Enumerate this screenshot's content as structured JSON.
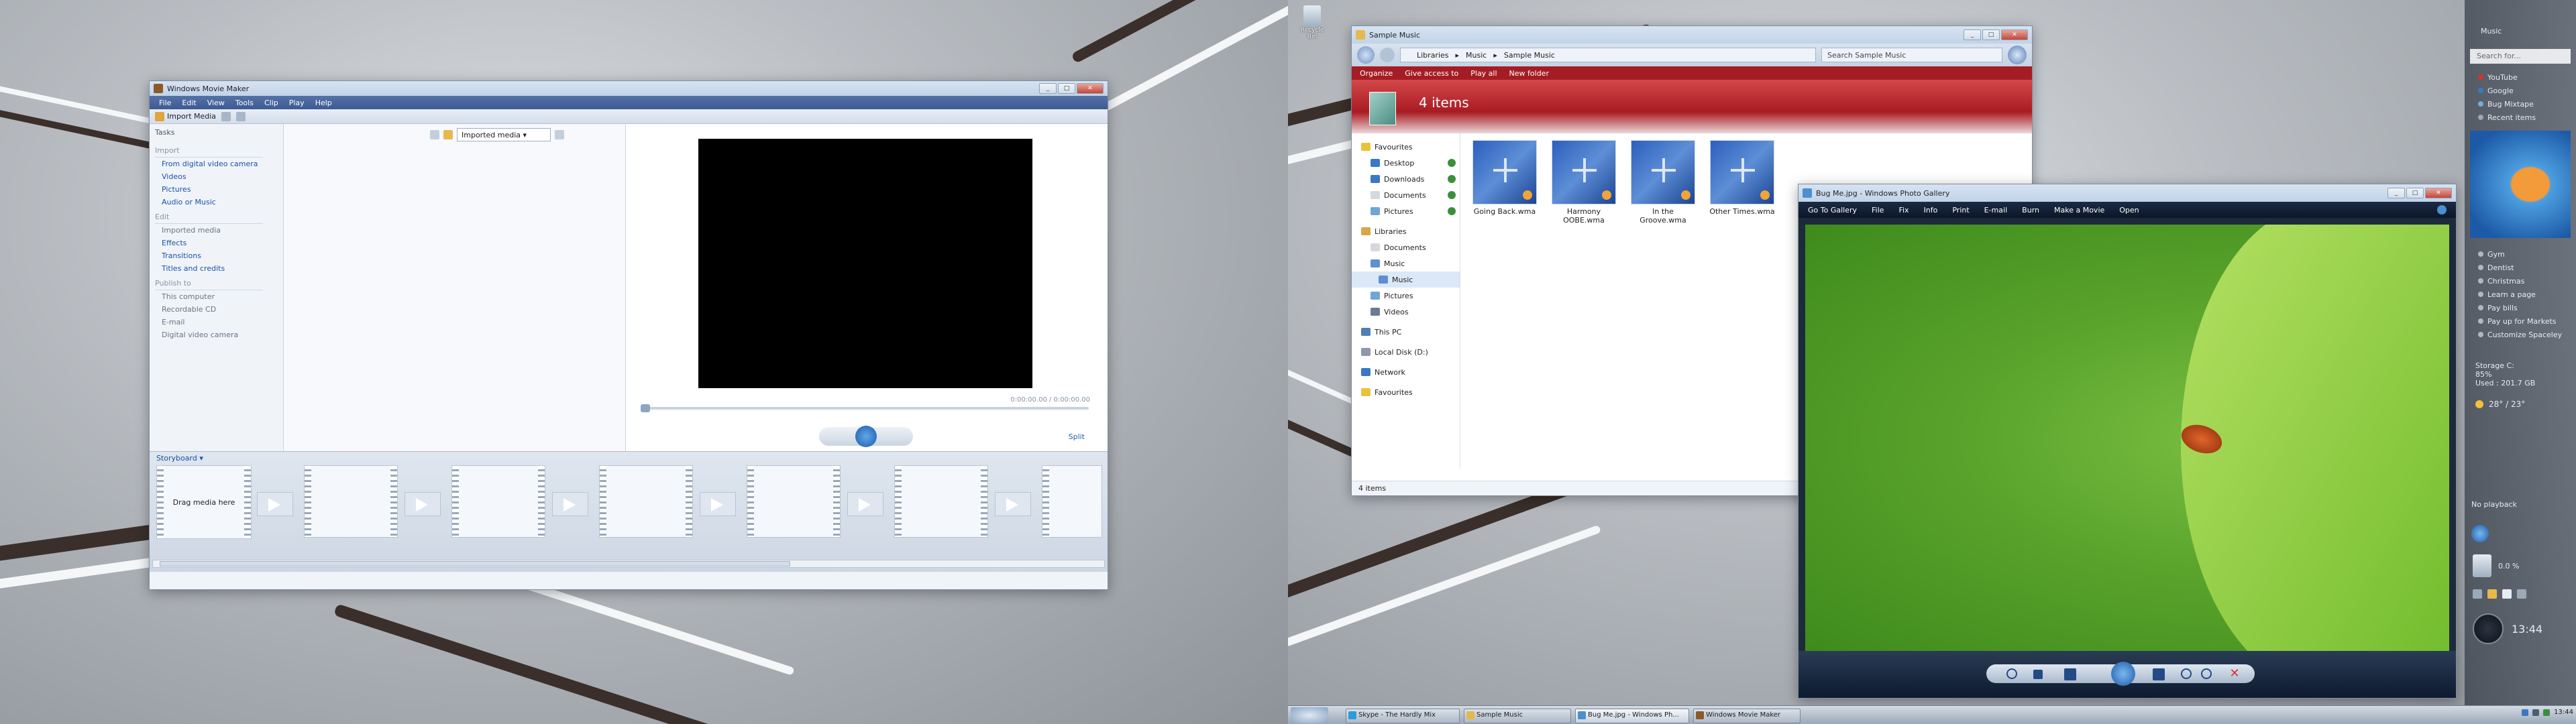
{
  "desktop": {
    "recycle_bin_label": "Recycle Bin"
  },
  "movie_maker": {
    "title": "Windows Movie Maker",
    "menu": [
      "File",
      "Edit",
      "View",
      "Tools",
      "Clip",
      "Play",
      "Help"
    ],
    "toolbar": {
      "import_media": "Import Media",
      "collection_select": "Imported media"
    },
    "tasks": {
      "heading": "Tasks",
      "import_heading": "Import",
      "import_links": [
        "From digital video camera",
        "Videos",
        "Pictures",
        "Audio or Music"
      ],
      "edit_heading": "Edit",
      "edit_links": [
        "Imported media",
        "Effects",
        "Transitions",
        "Titles and credits"
      ],
      "publish_heading": "Publish to",
      "publish_links": [
        "This computer",
        "Recordable CD",
        "E-mail",
        "Digital video camera"
      ]
    },
    "preview": {
      "time": "0:00:00.00 / 0:00:00.00",
      "split_label": "Split"
    },
    "storyboard": {
      "label": "Storyboard",
      "drag_hint": "Drag media here"
    }
  },
  "explorer": {
    "title": "Sample Music",
    "breadcrumb": [
      "Libraries",
      "Music",
      "Sample Music"
    ],
    "search_placeholder": "Search Sample Music",
    "command_bar": [
      "Organize",
      "Give access to",
      "Play all",
      "New folder"
    ],
    "header_count": "4 items",
    "nav": {
      "favourites": "Favourites",
      "favourite_items": [
        "Desktop",
        "Downloads",
        "Documents",
        "Pictures"
      ],
      "libraries": "Libraries",
      "library_items": [
        "Documents",
        "Music",
        "Music",
        "Pictures",
        "Videos"
      ],
      "this_pc": "This PC",
      "local_disk": "Local Disk (D:)",
      "network": "Network",
      "favourites2": "Favourites"
    },
    "files": [
      "Going Back.wma",
      "Harmony OOBE.wma",
      "In the Groove.wma",
      "Other Times.wma"
    ],
    "status": "4 items"
  },
  "photo_gallery": {
    "title": "Bug Me.jpg - Windows Photo Gallery",
    "toolbar": [
      "Go To Gallery",
      "File",
      "Fix",
      "Info",
      "Print",
      "E-mail",
      "Burn",
      "Make a Movie",
      "Open"
    ]
  },
  "sidebar": {
    "folder_label": "Music",
    "search_placeholder": "Search for...",
    "feeds": [
      "YouTube",
      "Google",
      "Bug Mixtape",
      "Recent items"
    ],
    "items": [
      "Gym",
      "Dentist",
      "Christmas",
      "Learn a page",
      "Pay bills",
      "Pay up for Markets",
      "Customize Spaceley"
    ],
    "disk_label": "Storage C:",
    "disk_pct": "85%",
    "disk_used": "Used : 201.7 GB",
    "weather": "28° / 23°",
    "media_status": "No playback",
    "cpu": "0.0 %",
    "clock": "13:44"
  },
  "taskbar": {
    "buttons": [
      "Skype - The Hardly Mix",
      "Sample Music",
      "Bug Me.jpg - Windows Ph...",
      "Windows Movie Maker"
    ],
    "tray_time": "13:44"
  }
}
